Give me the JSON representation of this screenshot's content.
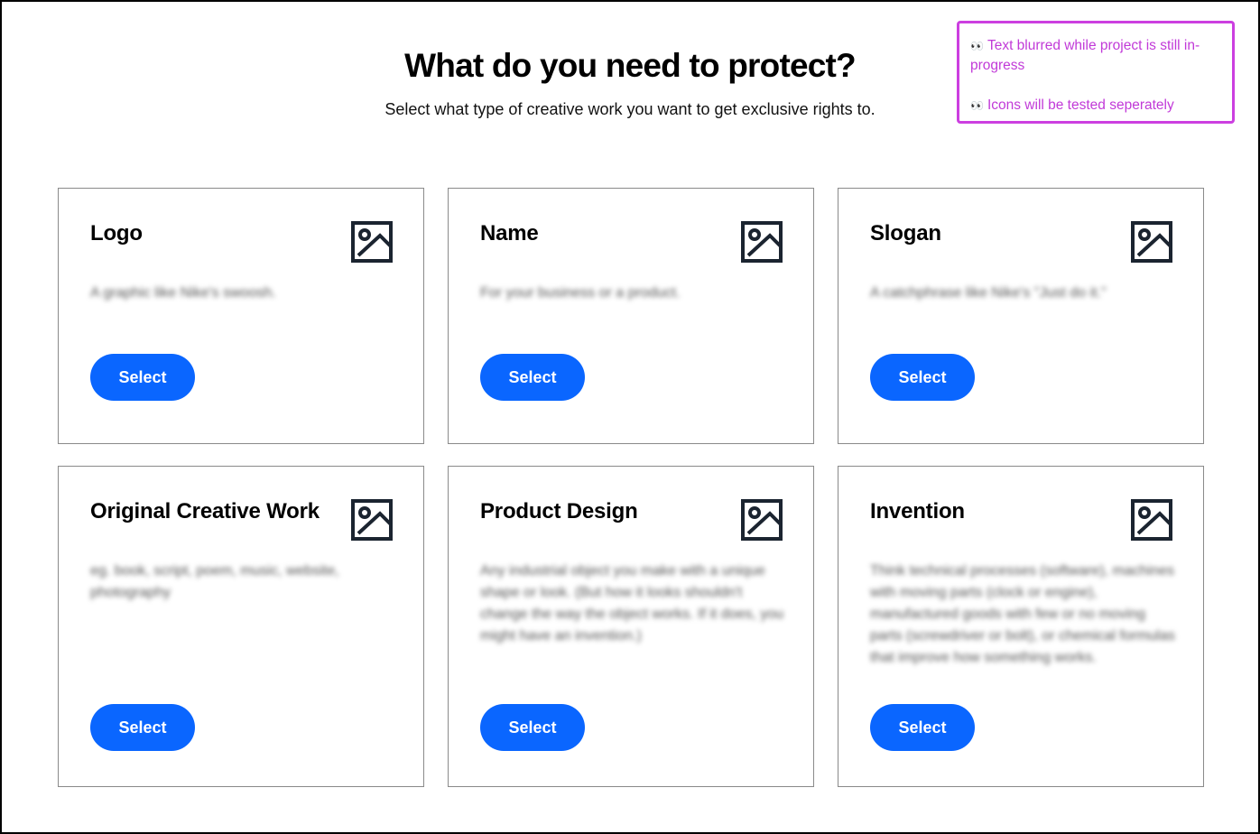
{
  "header": {
    "title": "What do you need to protect?",
    "subtitle": "Select what type of creative work you want to get exclusive rights to."
  },
  "note": {
    "border_color": "#cc3fe0",
    "lines": [
      {
        "icon": "eyes-emoji",
        "text": "Text blurred while project is still in-progress"
      },
      {
        "icon": "eyes-emoji",
        "text": "Icons will be tested seperately"
      }
    ]
  },
  "cards": [
    {
      "title": "Logo",
      "icon": "image-icon",
      "description": "A graphic like Nike's swoosh.",
      "button_label": "Select"
    },
    {
      "title": "Name",
      "icon": "image-icon",
      "description": "For your business or a product.",
      "button_label": "Select"
    },
    {
      "title": "Slogan",
      "icon": "image-icon",
      "description": "A catchphrase like Nike's \"Just do it.\"",
      "button_label": "Select"
    },
    {
      "title": "Original Creative Work",
      "icon": "image-icon",
      "description": "eg. book, script, poem, music, website, photography",
      "button_label": "Select"
    },
    {
      "title": "Product Design",
      "icon": "image-icon",
      "description": "Any industrial object you make with a unique shape or look. (But how it looks shouldn't change the way the object works. If it does, you might have an invention.)",
      "button_label": "Select"
    },
    {
      "title": "Invention",
      "icon": "image-icon",
      "description": "Think technical processes (software), machines with moving parts (clock or engine), manufactured goods with few or no moving parts (screwdriver or bolt), or chemical formulas that improve how something works.",
      "button_label": "Select"
    }
  ],
  "colors": {
    "accent": "#0a66ff",
    "note": "#c13ad8",
    "border": "#8a8a8a"
  }
}
